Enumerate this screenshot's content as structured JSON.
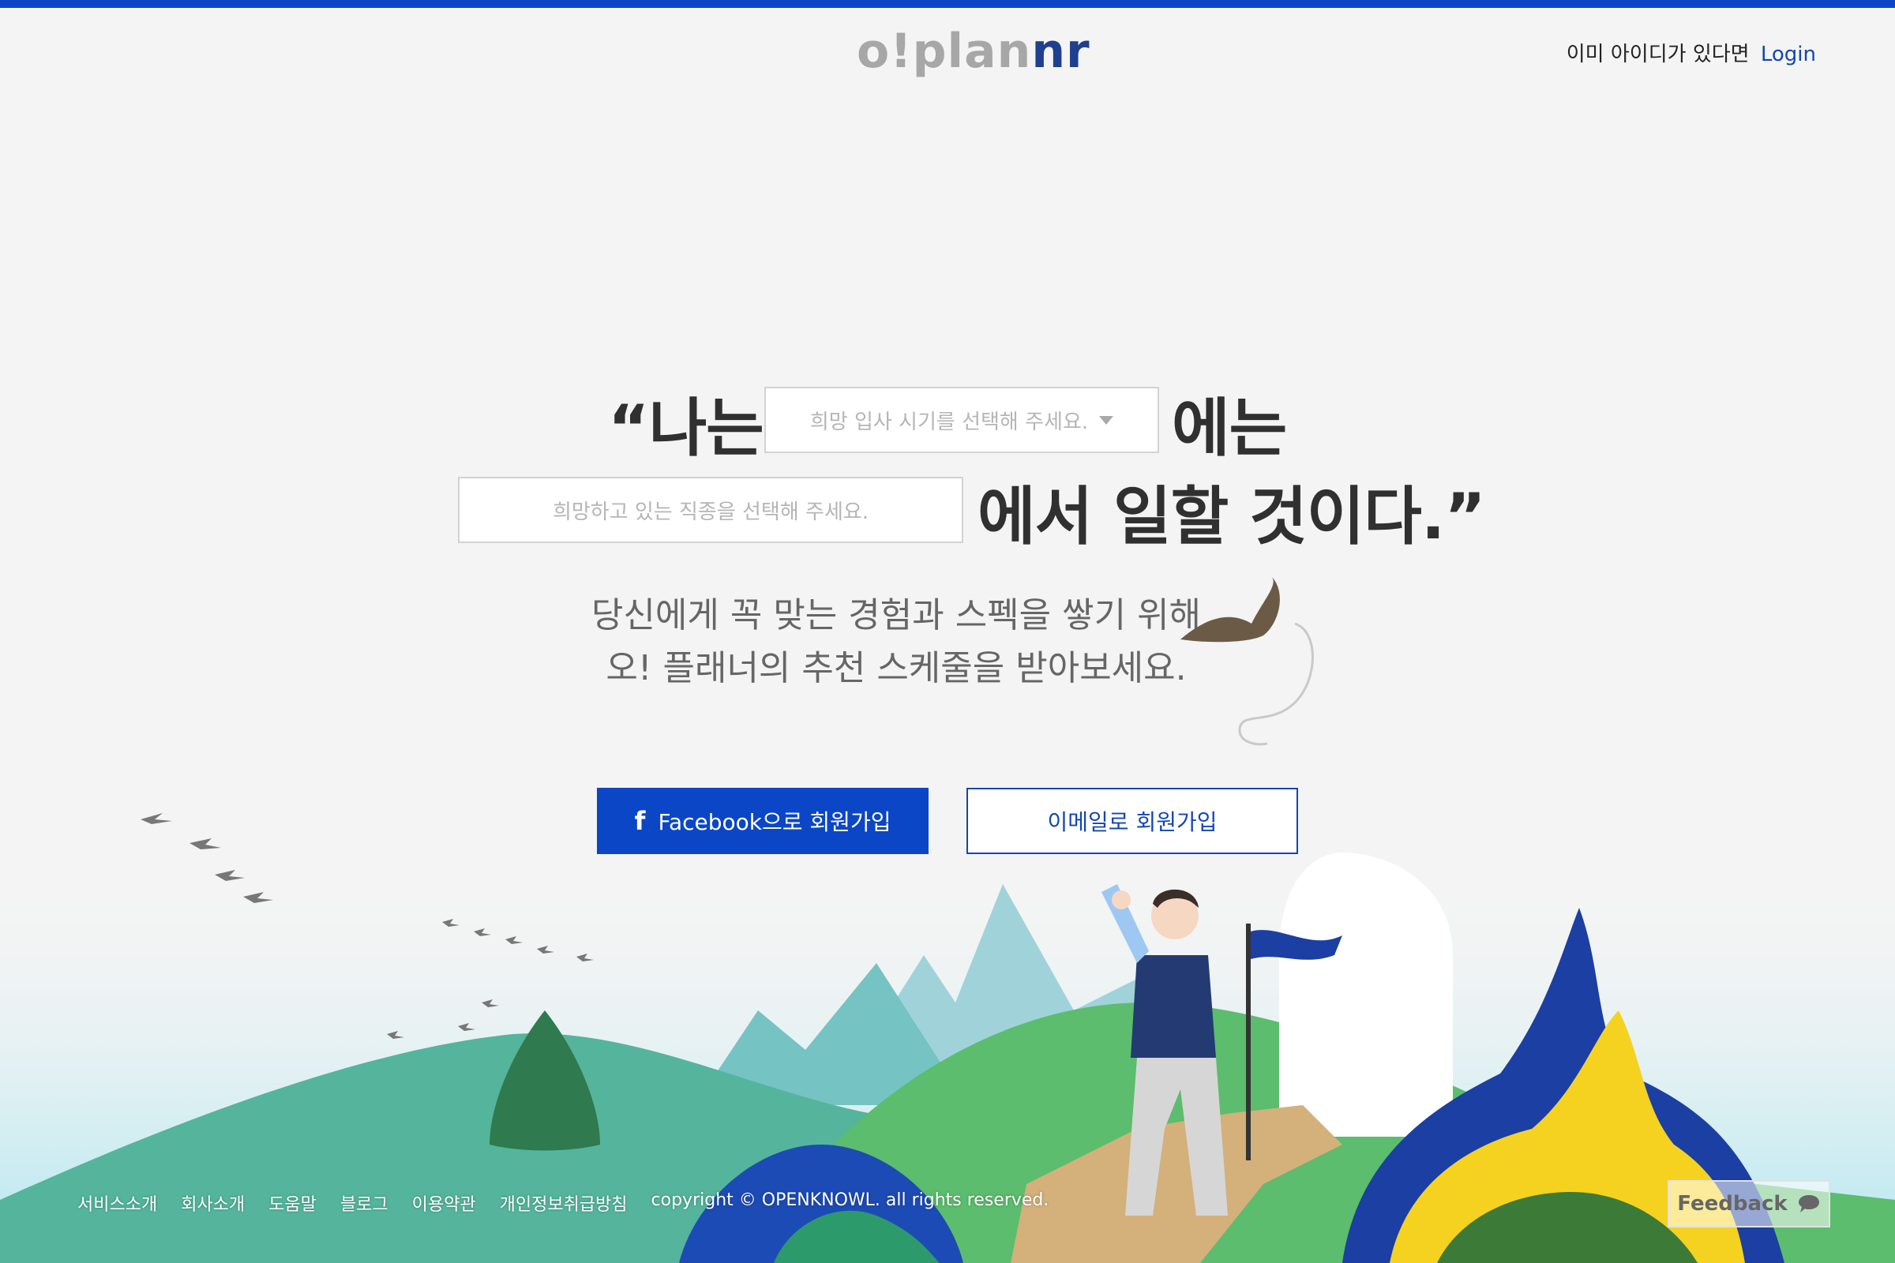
{
  "header": {
    "logo_grey": "o!plan",
    "logo_blue": "nr",
    "login_prompt": "이미 아이디가 있다면",
    "login_link": "Login"
  },
  "hero": {
    "line1_start": "“나는",
    "date_select_placeholder": "희망 입사 시기를 선택해 주세요.",
    "line1_end": "에는",
    "job_select_placeholder": "희망하고 있는 직종을 선택해 주세요.",
    "line2_end": "에서 일할 것이다.”",
    "subtitle_line1": "당신에게 꼭 맞는 경험과 스펙을 쌓기 위해",
    "subtitle_line2": "오! 플래너의 추천 스케줄을 받아보세요."
  },
  "actions": {
    "facebook_icon": "f",
    "facebook_label": "Facebook으로 회원가입",
    "email_label": "이메일로 회원가입"
  },
  "footer": {
    "links": [
      "서비스소개",
      "회사소개",
      "도움말",
      "블로그",
      "이용약관",
      "개인정보취급방침"
    ],
    "copyright": "copyright © OPENKNOWL. all rights reserved."
  },
  "feedback": {
    "label": "Feedback",
    "icon": "speech-bubble-icon"
  },
  "colors": {
    "accent": "#0b46c6",
    "background": "#f4f4f4",
    "headline": "#303030"
  }
}
